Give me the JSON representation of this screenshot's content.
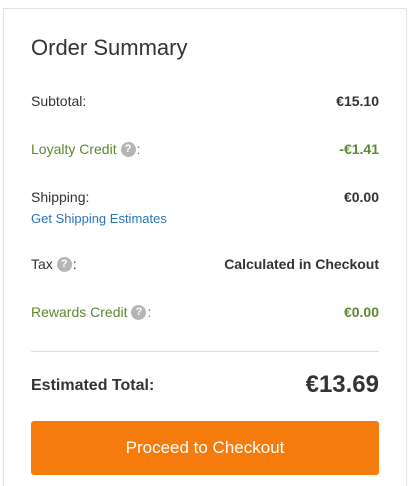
{
  "summary": {
    "title": "Order Summary",
    "subtotal": {
      "label": "Subtotal:",
      "value": "€15.10"
    },
    "loyalty": {
      "label": "Loyalty Credit",
      "colon": ":",
      "value": "-€1.41"
    },
    "shipping": {
      "label": "Shipping:",
      "value": "€0.00",
      "link": "Get Shipping Estimates"
    },
    "tax": {
      "label": "Tax",
      "colon": ":",
      "value": "Calculated in Checkout"
    },
    "rewards": {
      "label": "Rewards Credit",
      "colon": ":",
      "value": "€0.00"
    },
    "total": {
      "label": "Estimated Total:",
      "value": "€13.69"
    },
    "checkout_button": "Proceed to Checkout",
    "help_glyph": "?"
  },
  "colors": {
    "credit_green": "#5c8a2e",
    "link_blue": "#2d76b8",
    "button_orange": "#f57c0c",
    "help_icon_gray": "#b5b5b5"
  },
  "icons": [
    "help-icon"
  ]
}
